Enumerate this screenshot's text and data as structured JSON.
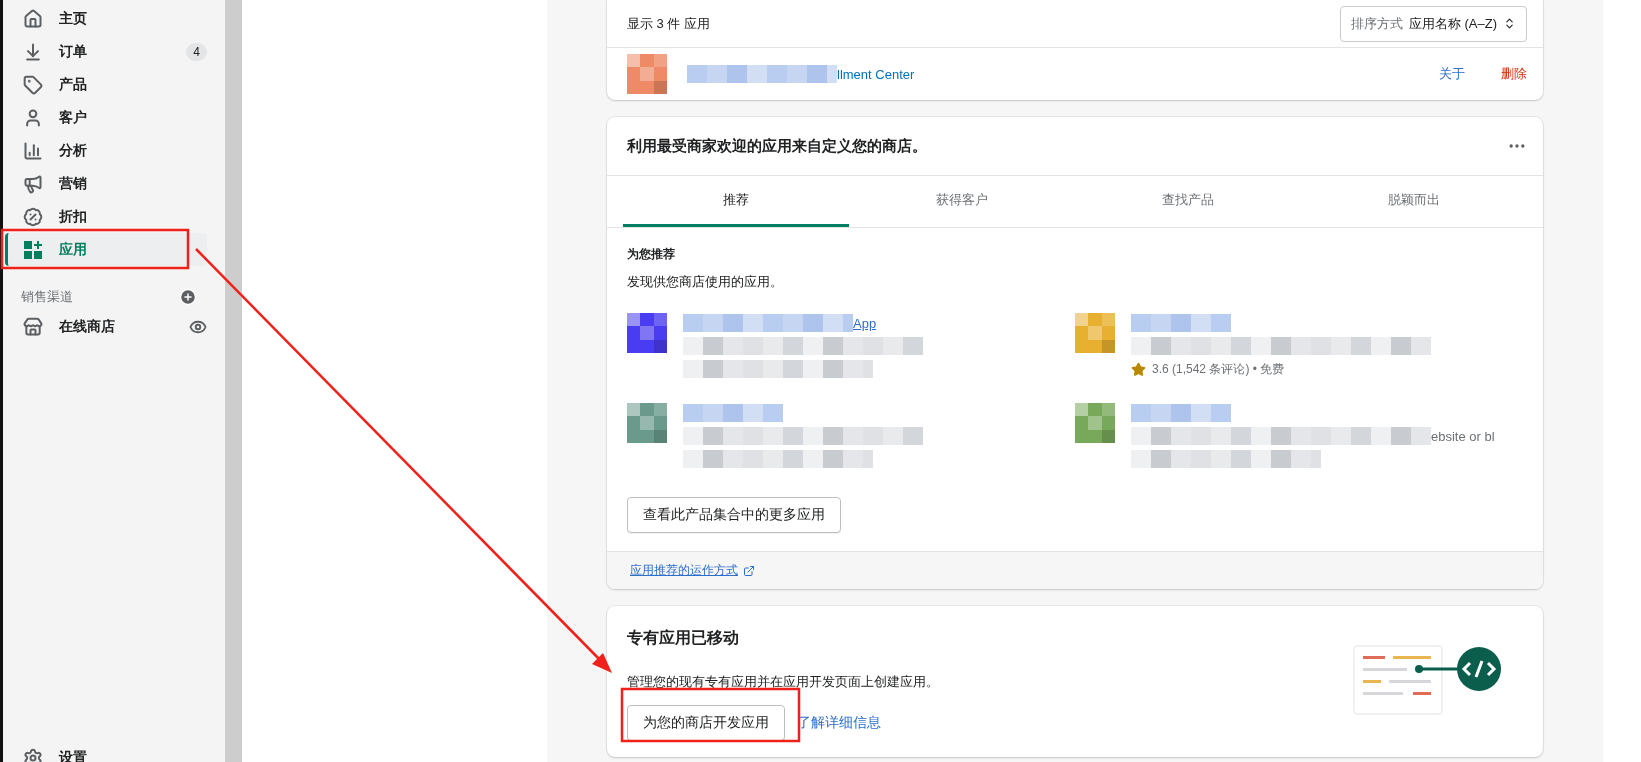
{
  "sidebar": {
    "items": [
      {
        "label": "主页",
        "kind": "home",
        "selected": false
      },
      {
        "label": "订单",
        "kind": "orders",
        "badge": "4",
        "selected": false
      },
      {
        "label": "产品",
        "kind": "products",
        "selected": false
      },
      {
        "label": "客户",
        "kind": "customers",
        "selected": false
      },
      {
        "label": "分析",
        "kind": "analytics",
        "selected": false
      },
      {
        "label": "营销",
        "kind": "marketing",
        "selected": false
      },
      {
        "label": "折扣",
        "kind": "discounts",
        "selected": false
      },
      {
        "label": "应用",
        "kind": "apps",
        "selected": true
      }
    ],
    "channels_heading": "销售渠道",
    "channels": [
      {
        "label": "在线商店",
        "kind": "store"
      }
    ],
    "settings": "设置"
  },
  "installed": {
    "summary": "显示 3 件 应用",
    "sort_label": "排序方式",
    "sort_value": "应用名称 (A–Z)",
    "app": {
      "name": "llment Center",
      "color": "#ee8a66",
      "actions": [
        {
          "label": "关于",
          "kind": "link"
        },
        {
          "label": "删除",
          "kind": "danger"
        }
      ]
    }
  },
  "recommend": {
    "title": "利用最受商家欢迎的应用来自定义您的商店。",
    "tabs": [
      {
        "label": "推荐",
        "selected": true
      },
      {
        "label": "获得客户",
        "selected": false
      },
      {
        "label": "查找产品",
        "selected": false
      },
      {
        "label": "脱颖而出",
        "selected": false
      }
    ],
    "section_title": "为您推荐",
    "subtitle": "发现供您商店使用的应用。",
    "apps": [
      {
        "color": "#4a3cf0",
        "name": "App"
      },
      {
        "color": "#e8b030",
        "meta": "3.6 (1,542 条评论) • 免费"
      },
      {
        "color": "#6a9a8c"
      },
      {
        "color": "#78a85a",
        "desc": "ebsite or bl"
      }
    ],
    "more_button": "查看此产品集合中的更多应用",
    "footer_link": "应用推荐的运作方式"
  },
  "custom": {
    "title": "专有应用已移动",
    "text": "管理您的现有专有应用并在应用开发页面上创建应用。",
    "button": "为您的商店开发应用",
    "link": "了解详细信息"
  },
  "annotations": [
    {
      "kind": "box"
    },
    {
      "kind": "arrow"
    },
    {
      "kind": "box"
    }
  ]
}
